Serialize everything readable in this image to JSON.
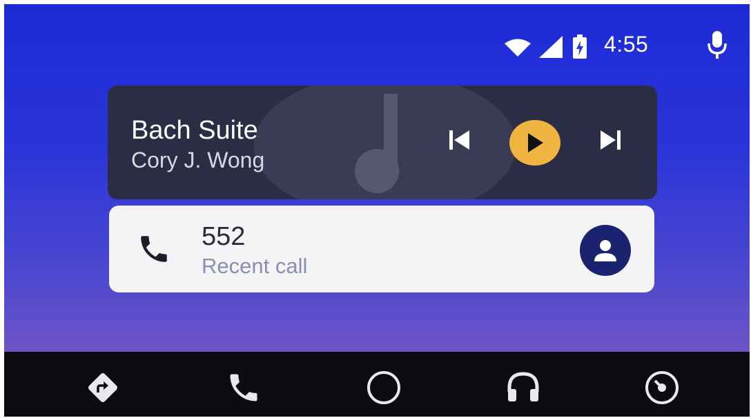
{
  "status_bar": {
    "time": "4:55",
    "icons": [
      "wifi-icon",
      "cell-signal-icon",
      "battery-charging-icon",
      "microphone-icon"
    ]
  },
  "media_card": {
    "title": "Bach Suite",
    "artist": "Cory J. Wong",
    "controls": [
      "skip-previous-icon",
      "play-icon",
      "skip-next-icon"
    ],
    "accent_color": "#f0b441",
    "background_color": "#2b2d45"
  },
  "call_card": {
    "number": "552",
    "subtitle": "Recent call",
    "icon": "phone-icon",
    "avatar_icon": "contact-person-icon",
    "avatar_color": "#1b2270"
  },
  "nav_bar": {
    "items": [
      "navigation-icon",
      "phone-icon",
      "home-icon",
      "headphones-icon",
      "exit-gauge-icon"
    ]
  }
}
